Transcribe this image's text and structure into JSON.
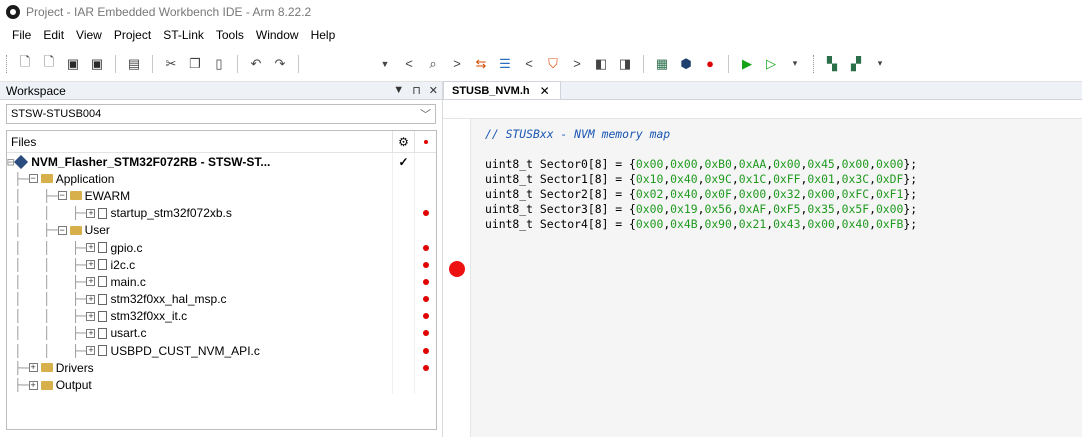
{
  "window": {
    "title": "Project - IAR Embedded Workbench IDE - Arm 8.22.2"
  },
  "menu": [
    "File",
    "Edit",
    "View",
    "Project",
    "ST-Link",
    "Tools",
    "Window",
    "Help"
  ],
  "workspace": {
    "header": "Workspace",
    "selector_value": "STSW-STUSB004",
    "tree_header": "Files",
    "project": "NVM_Flasher_STM32F072RB - STSW-ST...",
    "items": [
      {
        "label": "Application",
        "kind": "folder",
        "level": 1,
        "expander": "−"
      },
      {
        "label": "EWARM",
        "kind": "folder",
        "level": 2,
        "expander": "−"
      },
      {
        "label": "startup_stm32f072xb.s",
        "kind": "file",
        "level": 3,
        "expander": "+",
        "dot": true
      },
      {
        "label": "User",
        "kind": "folder",
        "level": 2,
        "expander": "−"
      },
      {
        "label": "gpio.c",
        "kind": "file",
        "level": 3,
        "expander": "+",
        "dot": true
      },
      {
        "label": "i2c.c",
        "kind": "file",
        "level": 3,
        "expander": "+",
        "dot": true
      },
      {
        "label": "main.c",
        "kind": "file",
        "level": 3,
        "expander": "+",
        "dot": true
      },
      {
        "label": "stm32f0xx_hal_msp.c",
        "kind": "file",
        "level": 3,
        "expander": "+",
        "dot": true
      },
      {
        "label": "stm32f0xx_it.c",
        "kind": "file",
        "level": 3,
        "expander": "+",
        "dot": true
      },
      {
        "label": "usart.c",
        "kind": "file",
        "level": 3,
        "expander": "+",
        "dot": true
      },
      {
        "label": "USBPD_CUST_NVM_API.c",
        "kind": "file",
        "level": 3,
        "expander": "+",
        "dot": true
      },
      {
        "label": "Drivers",
        "kind": "folder",
        "level": 1,
        "expander": "+",
        "dot": true
      },
      {
        "label": "Output",
        "kind": "folder",
        "level": 1,
        "expander": "+"
      }
    ]
  },
  "editor": {
    "tab": "STUSB_NVM.h",
    "comment": "// STUSBxx - NVM memory map",
    "lines": [
      {
        "decl": "uint8_t Sector0[8] = {",
        "values": [
          "0x00",
          "0x00",
          "0xB0",
          "0xAA",
          "0x00",
          "0x45",
          "0x00",
          "0x00"
        ]
      },
      {
        "decl": "uint8_t Sector1[8] = {",
        "values": [
          "0x10",
          "0x40",
          "0x9C",
          "0x1C",
          "0xFF",
          "0x01",
          "0x3C",
          "0xDF"
        ]
      },
      {
        "decl": "uint8_t Sector2[8] = {",
        "values": [
          "0x02",
          "0x40",
          "0x0F",
          "0x00",
          "0x32",
          "0x00",
          "0xFC",
          "0xF1"
        ]
      },
      {
        "decl": "uint8_t Sector3[8] = {",
        "values": [
          "0x00",
          "0x19",
          "0x56",
          "0xAF",
          "0xF5",
          "0x35",
          "0x5F",
          "0x00"
        ]
      },
      {
        "decl": "uint8_t Sector4[8] = {",
        "values": [
          "0x00",
          "0x4B",
          "0x90",
          "0x21",
          "0x43",
          "0x00",
          "0x40",
          "0xFB"
        ]
      }
    ]
  },
  "colors": {
    "comment": "#1a56b4",
    "number": "#1f9a1f",
    "breakpoint": "#ee1111"
  }
}
